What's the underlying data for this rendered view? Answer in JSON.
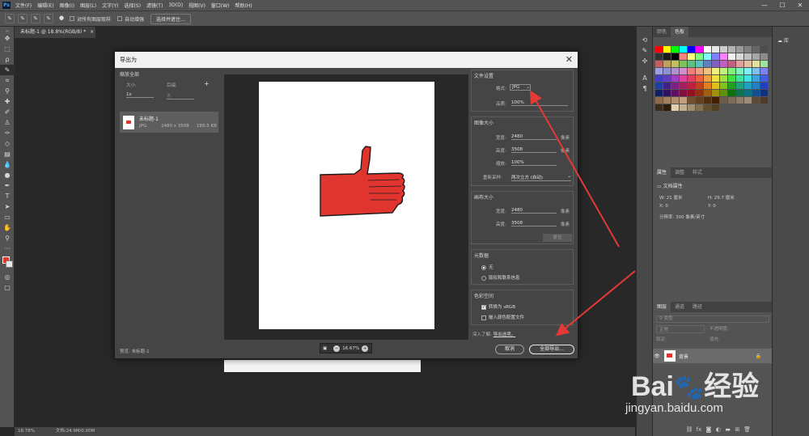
{
  "app": {
    "logo": "Ps"
  },
  "menu": [
    "文件(F)",
    "编辑(E)",
    "图像(I)",
    "图层(L)",
    "文字(Y)",
    "选择(S)",
    "滤镜(T)",
    "3D(D)",
    "视图(V)",
    "窗口(W)",
    "帮助(H)"
  ],
  "window_controls": {
    "minimize": "—",
    "maximize": "☐",
    "close": "✕"
  },
  "options_bar": {
    "sample_all_layers": "对所有图层取样",
    "auto_enhance": "自动增强",
    "select_subject": "选择并遮住..."
  },
  "document": {
    "tab_title": "未标题-1 @ 18.8%(RGB/8) *",
    "close": "×",
    "zoom": "18.78%",
    "doc_info": "文档:24.9M/0.00M"
  },
  "dialog": {
    "title": "导出为",
    "close": "✕",
    "left": {
      "scale_all": "缩放全部",
      "size_label": "大小:",
      "suffix_label": "后缀:",
      "add": "+",
      "size_value": "1x",
      "suffix_placeholder": "无",
      "asset": {
        "name": "未标题-1",
        "format": "JPG",
        "dims": "2480 x 3508",
        "filesize": "189.5 KB"
      },
      "preview_label": "预览: 未标题-1"
    },
    "zoom": {
      "value": "16.67%",
      "minus": "−",
      "plus": "+"
    },
    "file_settings": {
      "header": "文件设置",
      "format_label": "格式:",
      "format_value": "JPG",
      "quality_label": "品质:",
      "quality_value": "100%"
    },
    "image_size": {
      "header": "图像大小",
      "width_label": "宽度:",
      "width_value": "2480",
      "width_unit": "像素",
      "height_label": "高度:",
      "height_value": "3508",
      "height_unit": "像素",
      "scale_label": "缩放:",
      "scale_value": "100%",
      "resample_label": "重新采样:",
      "resample_value": "两次立方 (自动)"
    },
    "canvas_size": {
      "header": "画布大小",
      "width_label": "宽度:",
      "width_value": "2480",
      "width_unit": "像素",
      "height_label": "高度:",
      "height_value": "3508",
      "height_unit": "像素",
      "reset": "复位"
    },
    "metadata": {
      "header": "元数据",
      "none": "无",
      "copyright": "版权和联系信息"
    },
    "color_space": {
      "header": "色彩空间",
      "convert_srgb": "转换为 sRGB",
      "embed_profile": "嵌入颜色配置文件"
    },
    "learn_more": "深入了解:",
    "learn_more_link": "导出选项。",
    "cancel": "取消",
    "export_all": "全部导出..."
  },
  "panels": {
    "color_tabs": [
      "颜色",
      "色板"
    ],
    "library_label": "库",
    "props_tabs": [
      "属性",
      "调整",
      "样式"
    ],
    "doc_props": "文档属性",
    "w_label": "W:",
    "w_value": "21 厘米",
    "h_label": "H:",
    "h_value": "29.7 厘米",
    "x_label": "X:",
    "x_value": "0",
    "y_label": "Y:",
    "y_value": "0",
    "resolution": "分辨率: 300 像素/英寸",
    "layers_tabs": [
      "图层",
      "通道",
      "路径"
    ],
    "kind_label": "类型",
    "blend_mode": "正常",
    "opacity_label": "不透明度:",
    "lock_label": "锁定:",
    "fill_label": "填充:",
    "layer_name": "背景"
  },
  "swatch_colors": [
    "#ff0000",
    "#ffff00",
    "#00ff00",
    "#00ffff",
    "#0000ff",
    "#ff00ff",
    "#ffffff",
    "#e6e6e6",
    "#cccccc",
    "#b3b3b3",
    "#999999",
    "#808080",
    "#666666",
    "#4d4d4d",
    "#333333",
    "#1a1a1a",
    "#000000",
    "#ff8080",
    "#ffff80",
    "#80ff80",
    "#80ffff",
    "#8080ff",
    "#ff80ff",
    "#f2f2f2",
    "#d9d9d9",
    "#bfbfbf",
    "#a6a6a6",
    "#8c8c8c",
    "#c06060",
    "#c0a060",
    "#c0c060",
    "#80c060",
    "#60c080",
    "#60c0c0",
    "#6080c0",
    "#8060c0",
    "#c060c0",
    "#c06080",
    "#e0a0a0",
    "#e0c0a0",
    "#e0e0a0",
    "#a0e0a0",
    "#a0a0e0",
    "#9090d0",
    "#b090d0",
    "#d090d0",
    "#f08080",
    "#f0a080",
    "#f0c080",
    "#f0f080",
    "#c0f080",
    "#80f080",
    "#80f0c0",
    "#80f0f0",
    "#80c0f0",
    "#8080f0",
    "#4040c0",
    "#6040c0",
    "#a040c0",
    "#e040a0",
    "#e04060",
    "#f06040",
    "#f0a040",
    "#f0e040",
    "#a0e040",
    "#40e040",
    "#40e0a0",
    "#40e0e0",
    "#40a0e0",
    "#4060e0",
    "#2040a0",
    "#402080",
    "#802080",
    "#a02060",
    "#c02040",
    "#c04020",
    "#e08020",
    "#e0c020",
    "#80c020",
    "#20a020",
    "#20a080",
    "#20a0c0",
    "#2080c0",
    "#2040c0",
    "#102060",
    "#301060",
    "#601060",
    "#801040",
    "#901020",
    "#903010",
    "#a06010",
    "#a09010",
    "#609010",
    "#107010",
    "#107050",
    "#107080",
    "#105090",
    "#103080",
    "#8c6c4c",
    "#a08060",
    "#b09070",
    "#c0a080",
    "#705030",
    "#604020",
    "#503010",
    "#402000",
    "#6c5c4c",
    "#7c6c5c",
    "#8c7c6c",
    "#9c8c7c",
    "#5c4c3c",
    "#4c3c2c",
    "#3c2c1c",
    "#2c1c0c",
    "#e0d0b0",
    "#c0b090",
    "#a09070",
    "#807050",
    "#605030",
    "#504020"
  ],
  "watermark": {
    "brand": "Bai",
    "brand2": "经验",
    "url": "jingyan.baidu.com"
  }
}
